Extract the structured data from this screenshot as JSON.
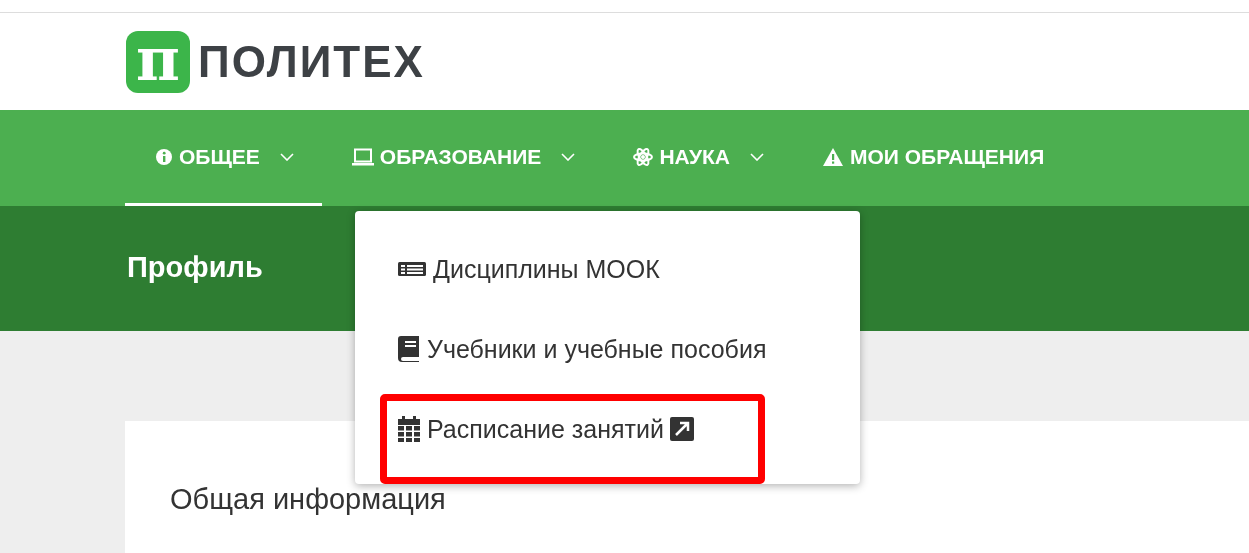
{
  "logo": {
    "mark": "π",
    "text": "ПОЛИТЕХ"
  },
  "nav": [
    {
      "label": "ОБЩЕЕ",
      "kind": "info",
      "has_caret": true,
      "selected": true
    },
    {
      "label": "ОБРАЗОВАНИЕ",
      "kind": "laptop",
      "has_caret": true,
      "selected": false
    },
    {
      "label": "НАУКА",
      "kind": "atom",
      "has_caret": true,
      "selected": false
    },
    {
      "label": "МОИ ОБРАЩЕНИЯ",
      "kind": "warning",
      "has_caret": false,
      "selected": false
    }
  ],
  "page_title": "Профиль",
  "dropdown": [
    {
      "label": "Дисциплины МООК",
      "kind": "list",
      "external": false,
      "highlighted": false
    },
    {
      "label": "Учебники и учебные пособия",
      "kind": "book",
      "external": false,
      "highlighted": false
    },
    {
      "label": "Расписание занятий",
      "kind": "calendar",
      "external": true,
      "highlighted": true
    }
  ],
  "card": {
    "title": "Общая информация"
  }
}
